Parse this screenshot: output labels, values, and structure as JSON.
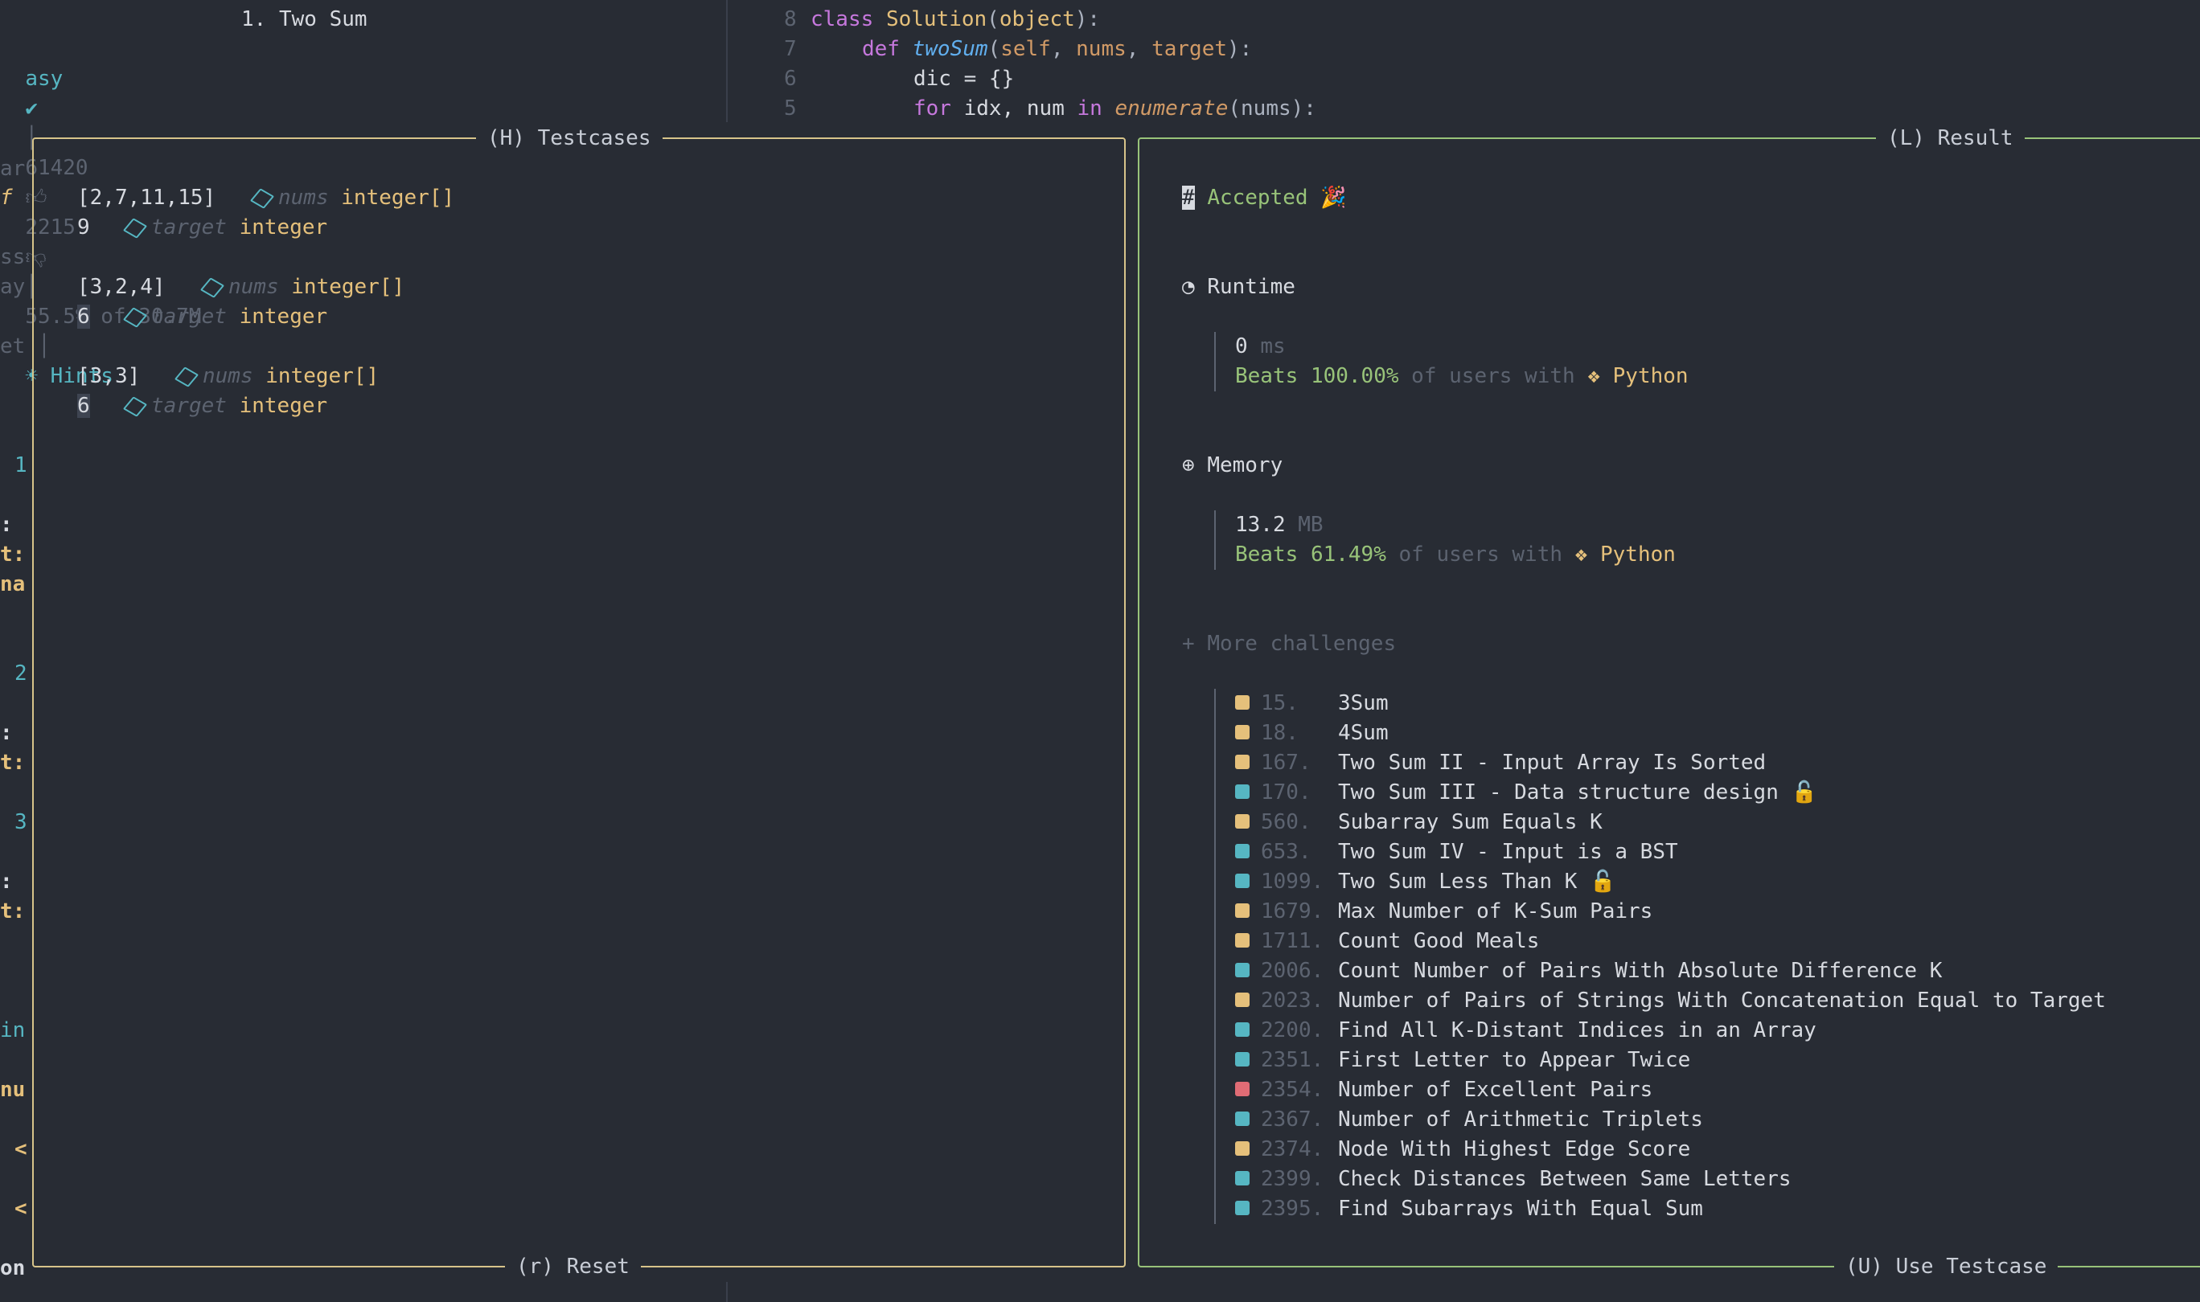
{
  "header": {
    "problem_title": "1. Two Sum",
    "difficulty_partial": "asy",
    "difficulty_check_icon": "check-circle-icon",
    "likes": "61420",
    "dislikes": "2215",
    "acceptance": "55.5% of 30.7M",
    "hints_label": "Hints"
  },
  "code": {
    "lines": [
      {
        "num": "8",
        "text": "class Solution(object):"
      },
      {
        "num": "7",
        "text": "def twoSum(self, nums, target):"
      },
      {
        "num": "6",
        "text": "dic = {}"
      },
      {
        "num": "5",
        "text": "for idx, num in enumerate(nums):"
      }
    ]
  },
  "left_gutter": [
    "ar",
    "f",
    "ss",
    "ay",
    "et",
    "1",
    ":",
    "t:",
    "na",
    "2",
    ":",
    "t:",
    "3",
    ":",
    "t:",
    "in",
    "nu",
    "<",
    "<",
    "on"
  ],
  "testcases": {
    "title": "(H) Testcases",
    "footer": "(r) Reset",
    "cases": [
      {
        "value1": "[2,7,11,15]",
        "name1": "nums",
        "type1": "integer[]",
        "value2": "9",
        "name2": "target",
        "type2": "integer"
      },
      {
        "value1": "[3,2,4]",
        "name1": "nums",
        "type1": "integer[]",
        "value2": "6",
        "name2": "target",
        "type2": "integer"
      },
      {
        "value1": "[3,3]",
        "name1": "nums",
        "type1": "integer[]",
        "value2": "6",
        "name2": "target",
        "type2": "integer"
      }
    ]
  },
  "result": {
    "title": "(L) Result",
    "footer": "(U) Use Testcase",
    "status": "Accepted",
    "runtime_label": "Runtime",
    "runtime_value": "0",
    "runtime_unit": "ms",
    "runtime_beats_prefix": "Beats",
    "runtime_beats": "100.00%",
    "of_users_with": "of users with",
    "language": "Python",
    "memory_label": "Memory",
    "memory_value": "13.2",
    "memory_unit": "MB",
    "memory_beats": "61.49%",
    "more_label": "More challenges",
    "challenges": [
      {
        "num": "15.",
        "title": "3Sum",
        "difficulty": "medium",
        "locked": false
      },
      {
        "num": "18.",
        "title": "4Sum",
        "difficulty": "medium",
        "locked": false
      },
      {
        "num": "167.",
        "title": "Two Sum II - Input Array Is Sorted",
        "difficulty": "medium",
        "locked": false
      },
      {
        "num": "170.",
        "title": "Two Sum III - Data structure design",
        "difficulty": "easy",
        "locked": true
      },
      {
        "num": "560.",
        "title": "Subarray Sum Equals K",
        "difficulty": "medium",
        "locked": false
      },
      {
        "num": "653.",
        "title": "Two Sum IV - Input is a BST",
        "difficulty": "easy",
        "locked": false
      },
      {
        "num": "1099.",
        "title": "Two Sum Less Than K",
        "difficulty": "easy",
        "locked": true
      },
      {
        "num": "1679.",
        "title": "Max Number of K-Sum Pairs",
        "difficulty": "medium",
        "locked": false
      },
      {
        "num": "1711.",
        "title": "Count Good Meals",
        "difficulty": "medium",
        "locked": false
      },
      {
        "num": "2006.",
        "title": "Count Number of Pairs With Absolute Difference K",
        "difficulty": "easy",
        "locked": false
      },
      {
        "num": "2023.",
        "title": "Number of Pairs of Strings With Concatenation Equal to Target",
        "difficulty": "medium",
        "locked": false
      },
      {
        "num": "2200.",
        "title": "Find All K-Distant Indices in an Array",
        "difficulty": "easy",
        "locked": false
      },
      {
        "num": "2351.",
        "title": "First Letter to Appear Twice",
        "difficulty": "easy",
        "locked": false
      },
      {
        "num": "2354.",
        "title": "Number of Excellent Pairs",
        "difficulty": "hard",
        "locked": false
      },
      {
        "num": "2367.",
        "title": "Number of Arithmetic Triplets",
        "difficulty": "easy",
        "locked": false
      },
      {
        "num": "2374.",
        "title": "Node With Highest Edge Score",
        "difficulty": "medium",
        "locked": false
      },
      {
        "num": "2399.",
        "title": "Check Distances Between Same Letters",
        "difficulty": "easy",
        "locked": false
      },
      {
        "num": "2395.",
        "title": "Find Subarrays With Equal Sum",
        "difficulty": "easy",
        "locked": false
      }
    ]
  },
  "colors": {
    "easy": "#56b6c2",
    "medium": "#e5c07b",
    "hard": "#e06c75",
    "testcases_border": "#d7c48a",
    "result_border": "#98c379",
    "background": "#282c34"
  }
}
